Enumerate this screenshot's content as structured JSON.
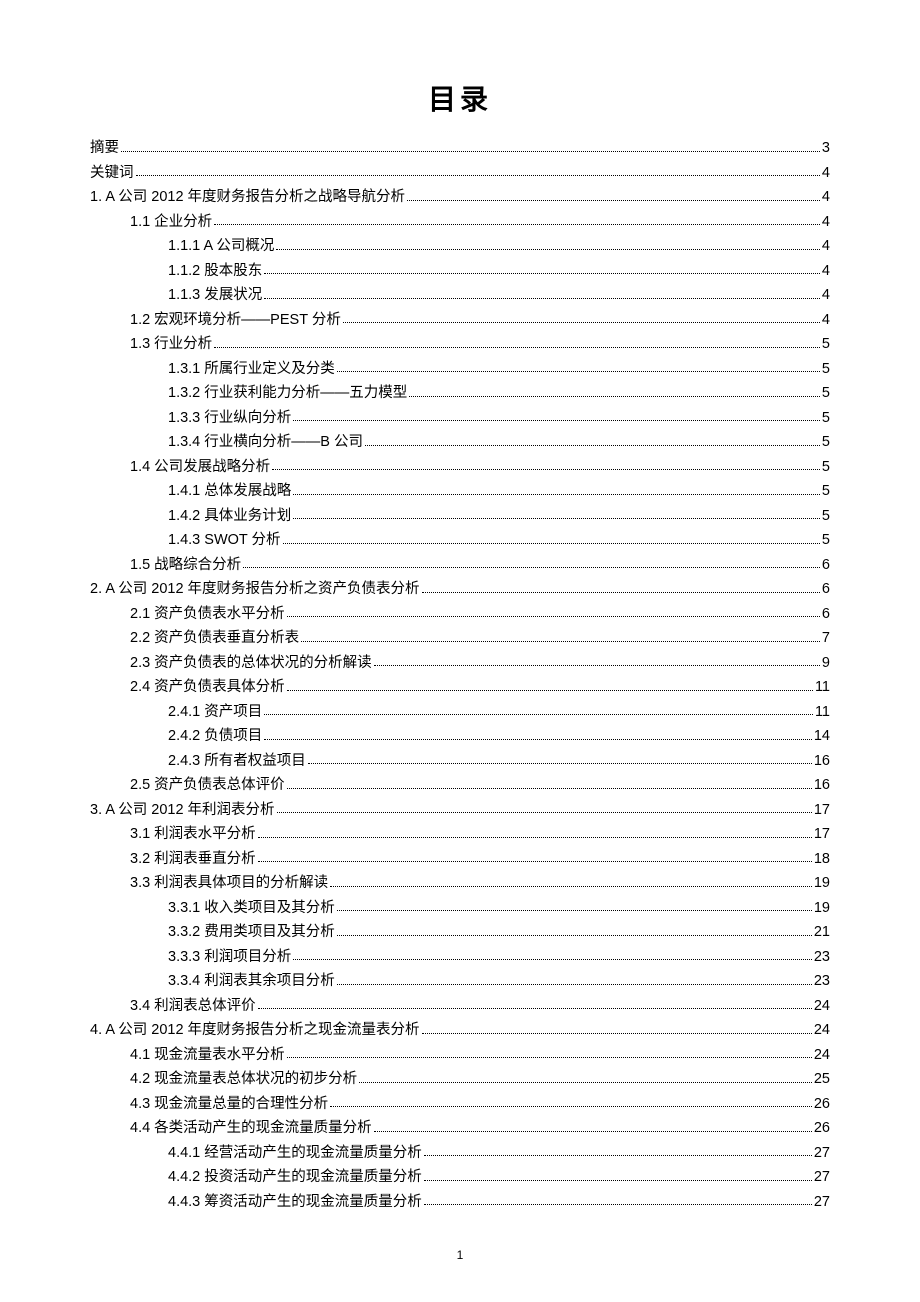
{
  "title": "目录",
  "page_number": "1",
  "toc": [
    {
      "level": 0,
      "label": "摘要",
      "page": "3"
    },
    {
      "level": 0,
      "label": "关键词",
      "page": "4"
    },
    {
      "level": 0,
      "label": "1. A 公司 2012 年度财务报告分析之战略导航分析",
      "page": "4"
    },
    {
      "level": 1,
      "label": "1.1  企业分析",
      "page": "4"
    },
    {
      "level": 2,
      "label": "1.1.1 A 公司概况",
      "page": "4"
    },
    {
      "level": 2,
      "label": "1.1.2  股本股东",
      "page": "4"
    },
    {
      "level": 2,
      "label": "1.1.3  发展状况",
      "page": "4"
    },
    {
      "level": 1,
      "label": "1.2  宏观环境分析——PEST 分析",
      "page": "4"
    },
    {
      "level": 1,
      "label": "1.3  行业分析",
      "page": "5"
    },
    {
      "level": 2,
      "label": "1.3.1  所属行业定义及分类",
      "page": "5"
    },
    {
      "level": 2,
      "label": "1.3.2  行业获利能力分析——五力模型",
      "page": "5"
    },
    {
      "level": 2,
      "label": "1.3.3  行业纵向分析",
      "page": "5"
    },
    {
      "level": 2,
      "label": "1.3.4  行业横向分析——B 公司",
      "page": "5"
    },
    {
      "level": 1,
      "label": "1.4  公司发展战略分析",
      "page": "5"
    },
    {
      "level": 2,
      "label": "1.4.1  总体发展战略",
      "page": "5"
    },
    {
      "level": 2,
      "label": "1.4.2  具体业务计划",
      "page": "5"
    },
    {
      "level": 2,
      "label": "1.4.3 SWOT 分析",
      "page": "5"
    },
    {
      "level": 1,
      "label": "1.5  战略综合分析",
      "page": "6"
    },
    {
      "level": 0,
      "label": "2. A 公司 2012 年度财务报告分析之资产负债表分析",
      "page": "6"
    },
    {
      "level": 1,
      "label": "2.1  资产负债表水平分析",
      "page": "6"
    },
    {
      "level": 1,
      "label": "2.2  资产负债表垂直分析表",
      "page": "7"
    },
    {
      "level": 1,
      "label": "2.3  资产负债表的总体状况的分析解读",
      "page": "9"
    },
    {
      "level": 1,
      "label": "2.4  资产负债表具体分析",
      "page": "11"
    },
    {
      "level": 2,
      "label": "2.4.1  资产项目",
      "page": "11"
    },
    {
      "level": 2,
      "label": "2.4.2  负债项目",
      "page": "14"
    },
    {
      "level": 2,
      "label": "2.4.3  所有者权益项目",
      "page": "16"
    },
    {
      "level": 1,
      "label": "2.5  资产负债表总体评价",
      "page": "16"
    },
    {
      "level": 0,
      "label": "3. A 公司 2012 年利润表分析",
      "page": "17"
    },
    {
      "level": 1,
      "label": "3.1 利润表水平分析",
      "page": "17"
    },
    {
      "level": 1,
      "label": "3.2  利润表垂直分析",
      "page": "18"
    },
    {
      "level": 1,
      "label": "3.3  利润表具体项目的分析解读",
      "page": "19"
    },
    {
      "level": 2,
      "label": "3.3.1  收入类项目及其分析",
      "page": "19"
    },
    {
      "level": 2,
      "label": "3.3.2  费用类项目及其分析",
      "page": "21"
    },
    {
      "level": 2,
      "label": "3.3.3  利润项目分析",
      "page": "23"
    },
    {
      "level": 2,
      "label": "3.3.4  利润表其余项目分析",
      "page": "23"
    },
    {
      "level": 1,
      "label": "3.4  利润表总体评价",
      "page": "24"
    },
    {
      "level": 0,
      "label": "4. A 公司 2012 年度财务报告分析之现金流量表分析",
      "page": "24"
    },
    {
      "level": 1,
      "label": "4.1  现金流量表水平分析",
      "page": "24"
    },
    {
      "level": 1,
      "label": "4.2  现金流量表总体状况的初步分析",
      "page": "25"
    },
    {
      "level": 1,
      "label": "4.3  现金流量总量的合理性分析",
      "page": "26"
    },
    {
      "level": 1,
      "label": "4.4  各类活动产生的现金流量质量分析",
      "page": "26"
    },
    {
      "level": 2,
      "label": "4.4.1  经营活动产生的现金流量质量分析",
      "page": "27"
    },
    {
      "level": 2,
      "label": "4.4.2  投资活动产生的现金流量质量分析",
      "page": "27"
    },
    {
      "level": 2,
      "label": "4.4.3  筹资活动产生的现金流量质量分析",
      "page": "27"
    }
  ]
}
